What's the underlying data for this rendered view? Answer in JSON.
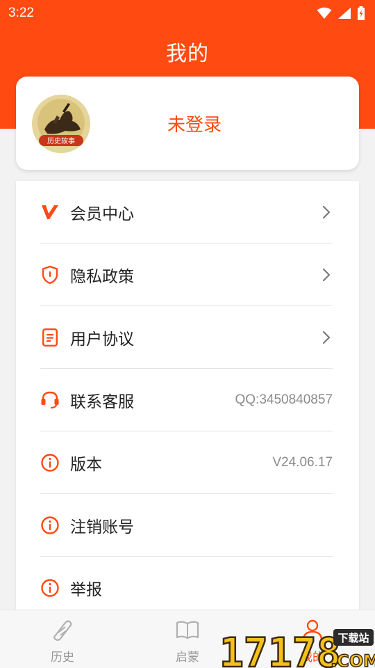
{
  "status_bar": {
    "time": "3:22"
  },
  "header": {
    "title": "我的"
  },
  "profile": {
    "login_text": "未登录",
    "avatar_caption": "历史故事"
  },
  "colors": {
    "accent": "#ff4a12",
    "background": "#f2f2f2"
  },
  "menu": {
    "items": [
      {
        "label": "会员中心",
        "icon": "vip-v-icon",
        "value": "",
        "has_arrow": true
      },
      {
        "label": "隐私政策",
        "icon": "shield-icon",
        "value": "",
        "has_arrow": true
      },
      {
        "label": "用户协议",
        "icon": "document-icon",
        "value": "",
        "has_arrow": true
      },
      {
        "label": "联系客服",
        "icon": "headset-icon",
        "value": "QQ:3450840857",
        "has_arrow": false
      },
      {
        "label": "版本",
        "icon": "info-icon",
        "value": "V24.06.17",
        "has_arrow": false
      },
      {
        "label": "注销账号",
        "icon": "info-icon",
        "value": "",
        "has_arrow": false
      },
      {
        "label": "举报",
        "icon": "info-icon",
        "value": "",
        "has_arrow": false
      }
    ]
  },
  "tabbar": {
    "tabs": [
      {
        "label": "历史",
        "icon": "scroll-icon"
      },
      {
        "label": "启蒙",
        "icon": "book-icon"
      },
      {
        "label": "我的",
        "icon": "profile-icon"
      }
    ]
  },
  "watermark": {
    "text": "17178",
    "badge": "下载站",
    "suffix": ".COM"
  }
}
